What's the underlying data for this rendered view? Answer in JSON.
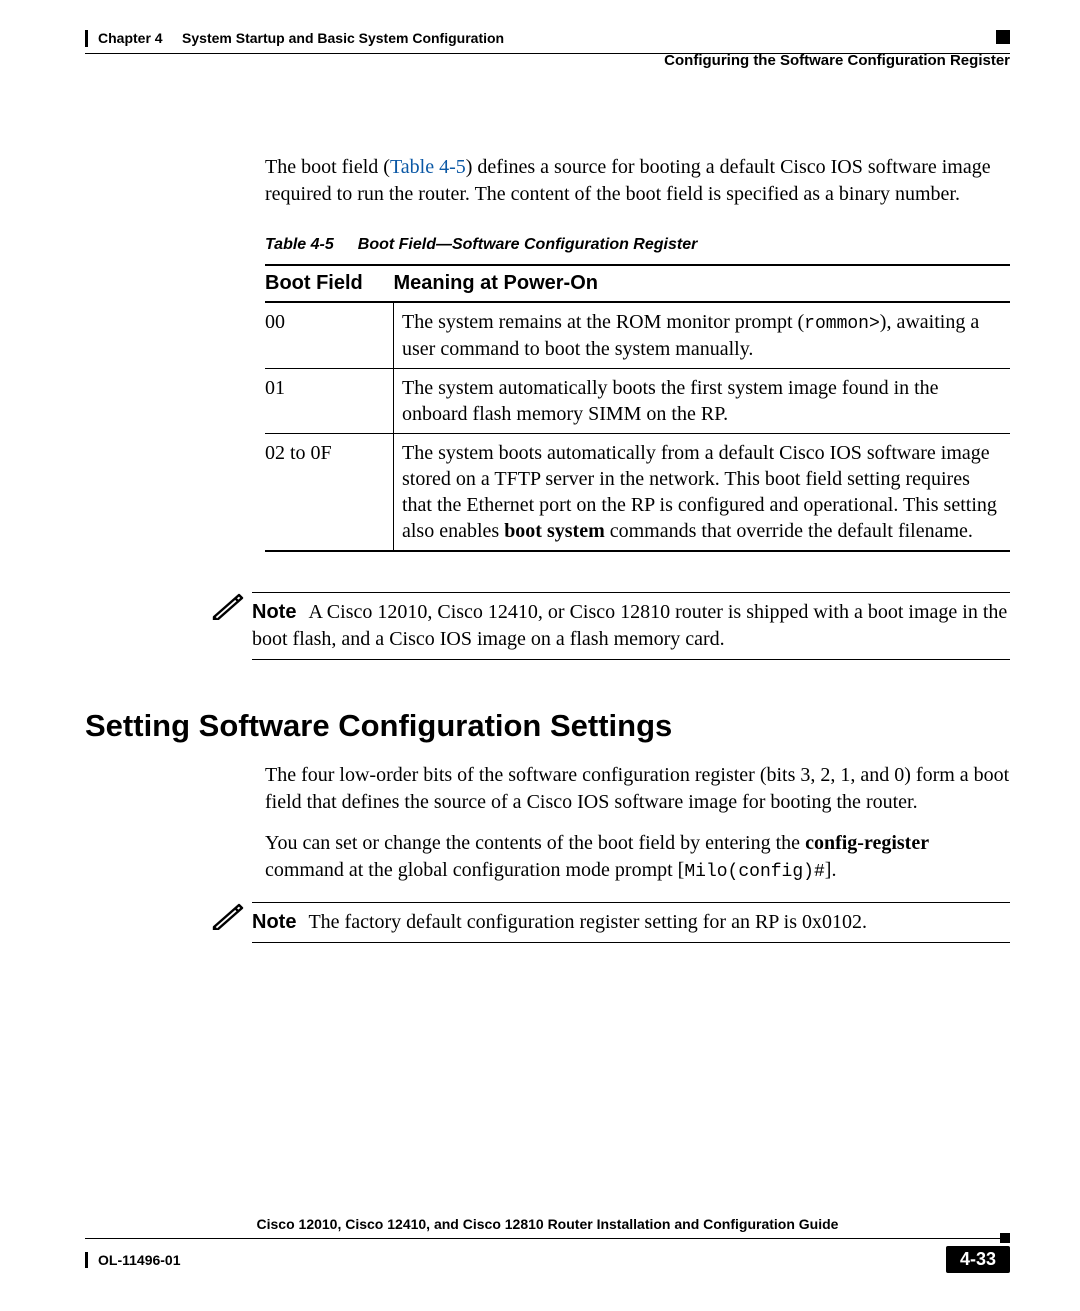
{
  "header": {
    "chapter_label": "Chapter 4",
    "chapter_title": "System Startup and Basic System Configuration",
    "section": "Configuring the Software Configuration Register"
  },
  "intro": {
    "pre_link": "The boot field (",
    "link": "Table 4-5",
    "post_link": ") defines a source for booting a default Cisco IOS software image required to run the router. The content of the boot field is specified as a binary number."
  },
  "table": {
    "caption_num": "Table 4-5",
    "caption_text": "Boot Field—Software Configuration Register",
    "headers": {
      "c1": "Boot Field",
      "c2": "Meaning at Power-On"
    },
    "rows": [
      {
        "field": "00",
        "pre": "The system remains at the ROM monitor prompt (",
        "mono": "rommon>",
        "post": "), awaiting a user command to boot the system manually."
      },
      {
        "field": "01",
        "text": "The system automatically boots the first system image found in the onboard flash memory SIMM on the RP."
      },
      {
        "field": "02 to 0F",
        "pre": "The system boots automatically from a default Cisco IOS software image stored on a TFTP server in the network. This boot field setting requires that the Ethernet port on the RP is configured and operational. This setting also enables ",
        "bold": "boot system",
        "post": " commands that override the default filename."
      }
    ]
  },
  "note1": {
    "label": "Note",
    "text": "A Cisco 12010, Cisco 12410, or Cisco 12810 router is shipped with a boot image in the boot flash, and a Cisco IOS image on a flash memory card."
  },
  "section_heading": "Setting Software Configuration Settings",
  "sec_para1": "The four low-order bits of the software configuration register (bits 3, 2, 1, and 0) form a boot field that defines the source of a Cisco IOS software image for booting the router.",
  "sec_para2": {
    "pre": "You can set or change the contents of the boot field by entering the ",
    "bold": "config-register",
    "mid": " command at the global configuration mode prompt [",
    "mono": "Milo(config)#",
    "post": "]."
  },
  "note2": {
    "label": "Note",
    "text": "The factory default configuration register setting for an RP is 0x0102."
  },
  "footer": {
    "guide": "Cisco 12010, Cisco 12410, and Cisco 12810 Router Installation and Configuration Guide",
    "doc_id": "OL-11496-01",
    "page": "4-33"
  }
}
